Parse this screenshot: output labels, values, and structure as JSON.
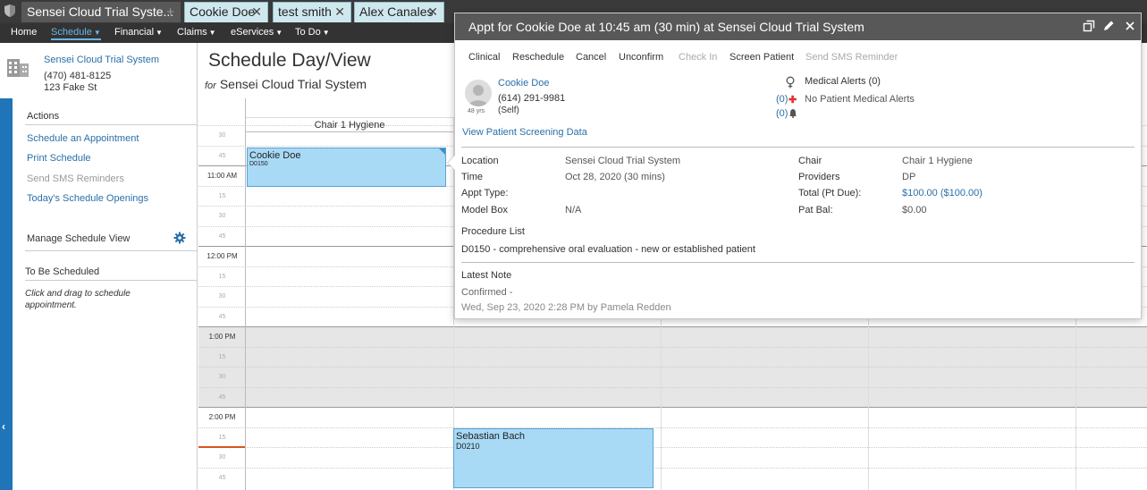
{
  "tabs": {
    "main": "Sensei Cloud Trial Syste...",
    "patients": [
      "Cookie Doe",
      "test smith",
      "Alex Canales"
    ]
  },
  "nav": {
    "items": [
      "Home",
      "Schedule",
      "Financial",
      "Claims",
      "eServices",
      "To Do"
    ],
    "active": "Schedule"
  },
  "office": {
    "name": "Sensei Cloud Trial System",
    "phone": "(470) 481-8125",
    "address": "123 Fake St"
  },
  "sidebar": {
    "actions_title": "Actions",
    "actions": [
      {
        "label": "Schedule an Appointment",
        "enabled": true
      },
      {
        "label": "Print Schedule",
        "enabled": true
      },
      {
        "label": "Send SMS Reminders",
        "enabled": false
      },
      {
        "label": "Today's Schedule Openings",
        "enabled": true
      }
    ],
    "manage_title": "Manage Schedule View",
    "tbs_title": "To Be Scheduled",
    "tbs_hint": "Click and drag to schedule appointment."
  },
  "page": {
    "title": "Schedule Day/View",
    "sub_for": "for",
    "sub_office": "Sensei Cloud Trial System"
  },
  "schedule": {
    "column": "Chair 1 Hygiene",
    "times": [
      "30",
      "45",
      "11:00 AM",
      "15",
      "30",
      "45",
      "12:00 PM",
      "15",
      "30",
      "45",
      "1:00 PM",
      "15",
      "30",
      "45",
      "2:00 PM",
      "15",
      "30",
      "45"
    ],
    "appointments": [
      {
        "name": "Cookie Doe",
        "code": "D0150"
      },
      {
        "name": "Sebastian Bach",
        "code": "D0210"
      }
    ]
  },
  "popover": {
    "title": "Appt for Cookie Doe at 10:45 am (30 min) at Sensei Cloud Trial System",
    "actions": [
      {
        "label": "Clinical",
        "enabled": true
      },
      {
        "label": "Reschedule",
        "enabled": true
      },
      {
        "label": "Cancel",
        "enabled": true
      },
      {
        "label": "Unconfirm",
        "enabled": true
      },
      {
        "label": "Check In",
        "enabled": false
      },
      {
        "label": "Screen Patient",
        "enabled": true
      },
      {
        "label": "Send SMS Reminder",
        "enabled": false
      }
    ],
    "patient": {
      "name": "Cookie Doe",
      "phone": "(614) 291-9981",
      "relation": "(Self)",
      "age": "48 yrs"
    },
    "screening_link": "View Patient Screening Data",
    "medical_alerts_title": "Medical Alerts (0)",
    "count_alerts": "(0)",
    "no_alerts": "No Patient Medical Alerts",
    "count_reminders": "(0)",
    "details_left": [
      {
        "label": "Location",
        "value": "Sensei Cloud Trial System"
      },
      {
        "label": "Time",
        "value": "Oct 28, 2020 (30 mins)"
      },
      {
        "label": "Appt Type:",
        "value": ""
      },
      {
        "label": "Model Box",
        "value": "N/A"
      }
    ],
    "details_right": [
      {
        "label": "Chair",
        "value": "Chair 1 Hygiene"
      },
      {
        "label": "Providers",
        "value": "DP"
      },
      {
        "label": "Total (Pt Due):",
        "value": "$100.00 ($100.00)"
      },
      {
        "label": "Pat Bal:",
        "value": "$0.00"
      }
    ],
    "procedure_list_title": "Procedure List",
    "procedure": "D0150 - comprehensive oral evaluation - new or established patient",
    "latest_note_title": "Latest Note",
    "note_text": "Confirmed -",
    "note_meta": "Wed, Sep 23, 2020 2:28 PM by Pamela Redden"
  },
  "colors": {
    "accent": "#2a6fa8",
    "appointment": "#a8daf6",
    "header": "#585858",
    "sidebar_strip": "#1f75b8"
  }
}
